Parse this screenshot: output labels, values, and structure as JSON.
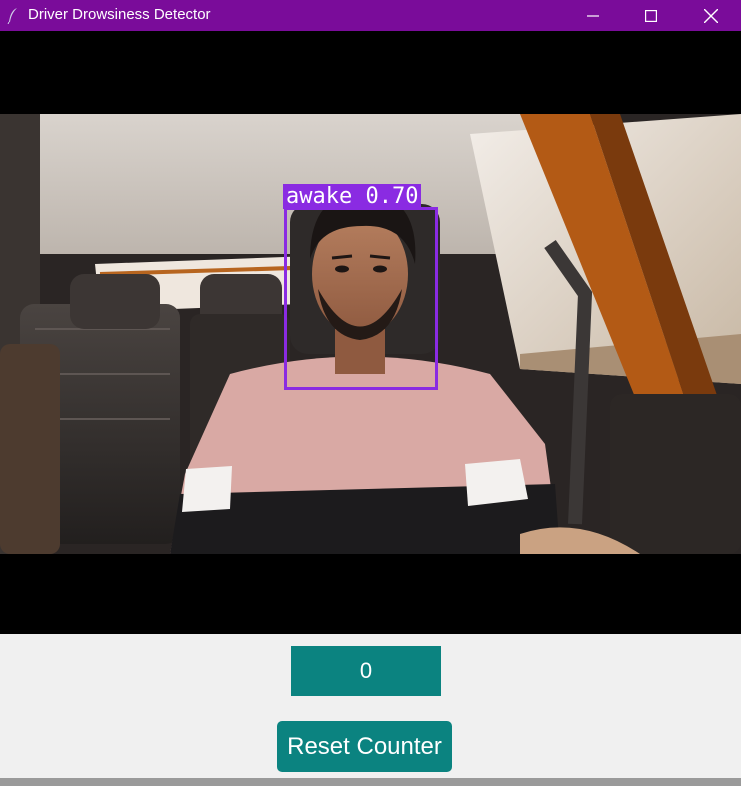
{
  "window": {
    "title": "Driver Drowsiness Detector",
    "titlebar_color": "#7a0c9a",
    "controls": [
      "minimize-icon",
      "maximize-icon",
      "close-icon"
    ]
  },
  "video": {
    "detection": {
      "label": "awake 0.70",
      "box_color": "#8a2be2"
    }
  },
  "counter": {
    "value": "0",
    "color": "#0b8380"
  },
  "reset_button": {
    "label": "Reset Counter",
    "color": "#0b8380"
  }
}
